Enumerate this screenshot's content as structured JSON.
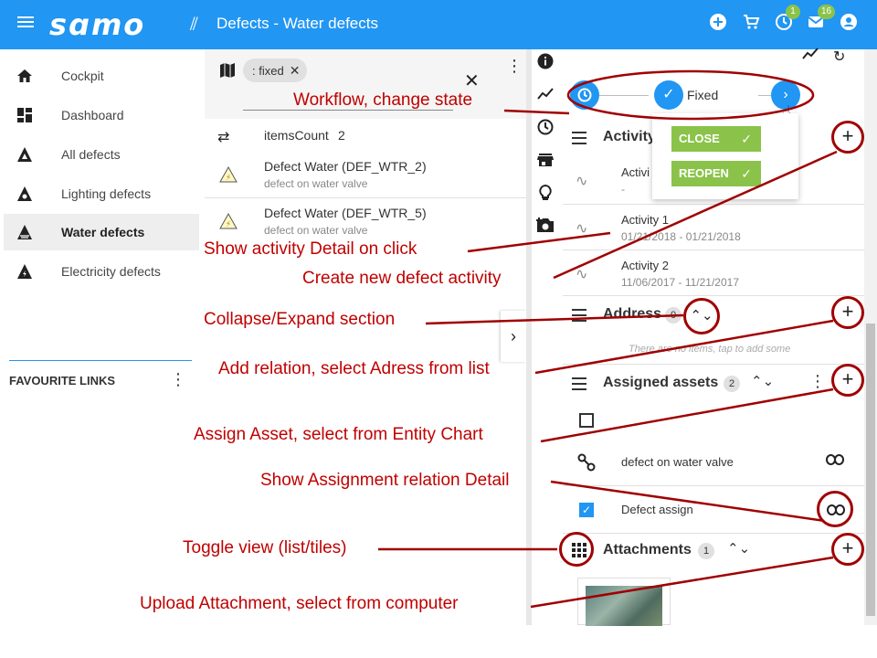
{
  "topbar": {
    "logo": "ꜱɑmo",
    "title": "Defects - Water defects",
    "history_badge": "1",
    "mail_badge": "16"
  },
  "sidebar": {
    "items": [
      {
        "label": "Cockpit",
        "icon": "home-icon"
      },
      {
        "label": "Dashboard",
        "icon": "dashboard-icon"
      },
      {
        "label": "All defects",
        "icon": "triangle-icon"
      },
      {
        "label": "Lighting defects",
        "icon": "lighting-icon"
      },
      {
        "label": "Water defects",
        "icon": "water-icon"
      },
      {
        "label": "Electricity defects",
        "icon": "electricity-icon"
      }
    ],
    "favourite_title": "FAVOURITE LINKS"
  },
  "list": {
    "filter_chip": ": fixed",
    "items_count_label": "itemsCount",
    "items_count_value": "2",
    "rows": [
      {
        "title": "Defect Water (DEF_WTR_2)",
        "subtitle": "defect on water valve"
      },
      {
        "title": "Defect Water (DEF_WTR_5)",
        "subtitle": "defect on water valve"
      }
    ]
  },
  "workflow": {
    "state_label": "Fixed",
    "actions": [
      "CLOSE",
      "REOPEN"
    ]
  },
  "detail": {
    "activity_title": "Activity",
    "activities": [
      {
        "name": "Activi",
        "dates": "-"
      },
      {
        "name": "Activity 1",
        "dates": "01/21/2018 - 01/21/2018"
      },
      {
        "name": "Activity 2",
        "dates": "11/06/2017 - 11/21/2017"
      }
    ],
    "address_title": "Address",
    "address_count": "0",
    "address_empty": "There are no items, tap to add some",
    "assets_title": "Assigned assets",
    "assets_count": "2",
    "assets": [
      {
        "label": "defect on water valve"
      },
      {
        "label": "Defect assign"
      }
    ],
    "attachments_title": "Attachments",
    "attachments_count": "1"
  },
  "annotations": {
    "workflow": "Workflow, change state",
    "activity_detail": "Show activity Detail on click",
    "create_activity": "Create new defect activity",
    "collapse": "Collapse/Expand section",
    "add_relation": "Add relation, select Adress from list",
    "assign_asset": "Assign Asset, select from Entity Chart",
    "assignment_detail": "Show Assignment relation Detail",
    "toggle_view": "Toggle view (list/tiles)",
    "upload": "Upload Attachment, select from computer"
  },
  "colors": {
    "primary": "#2196f3",
    "accent_green": "#8bc34a",
    "annotation_red": "#c00000"
  }
}
